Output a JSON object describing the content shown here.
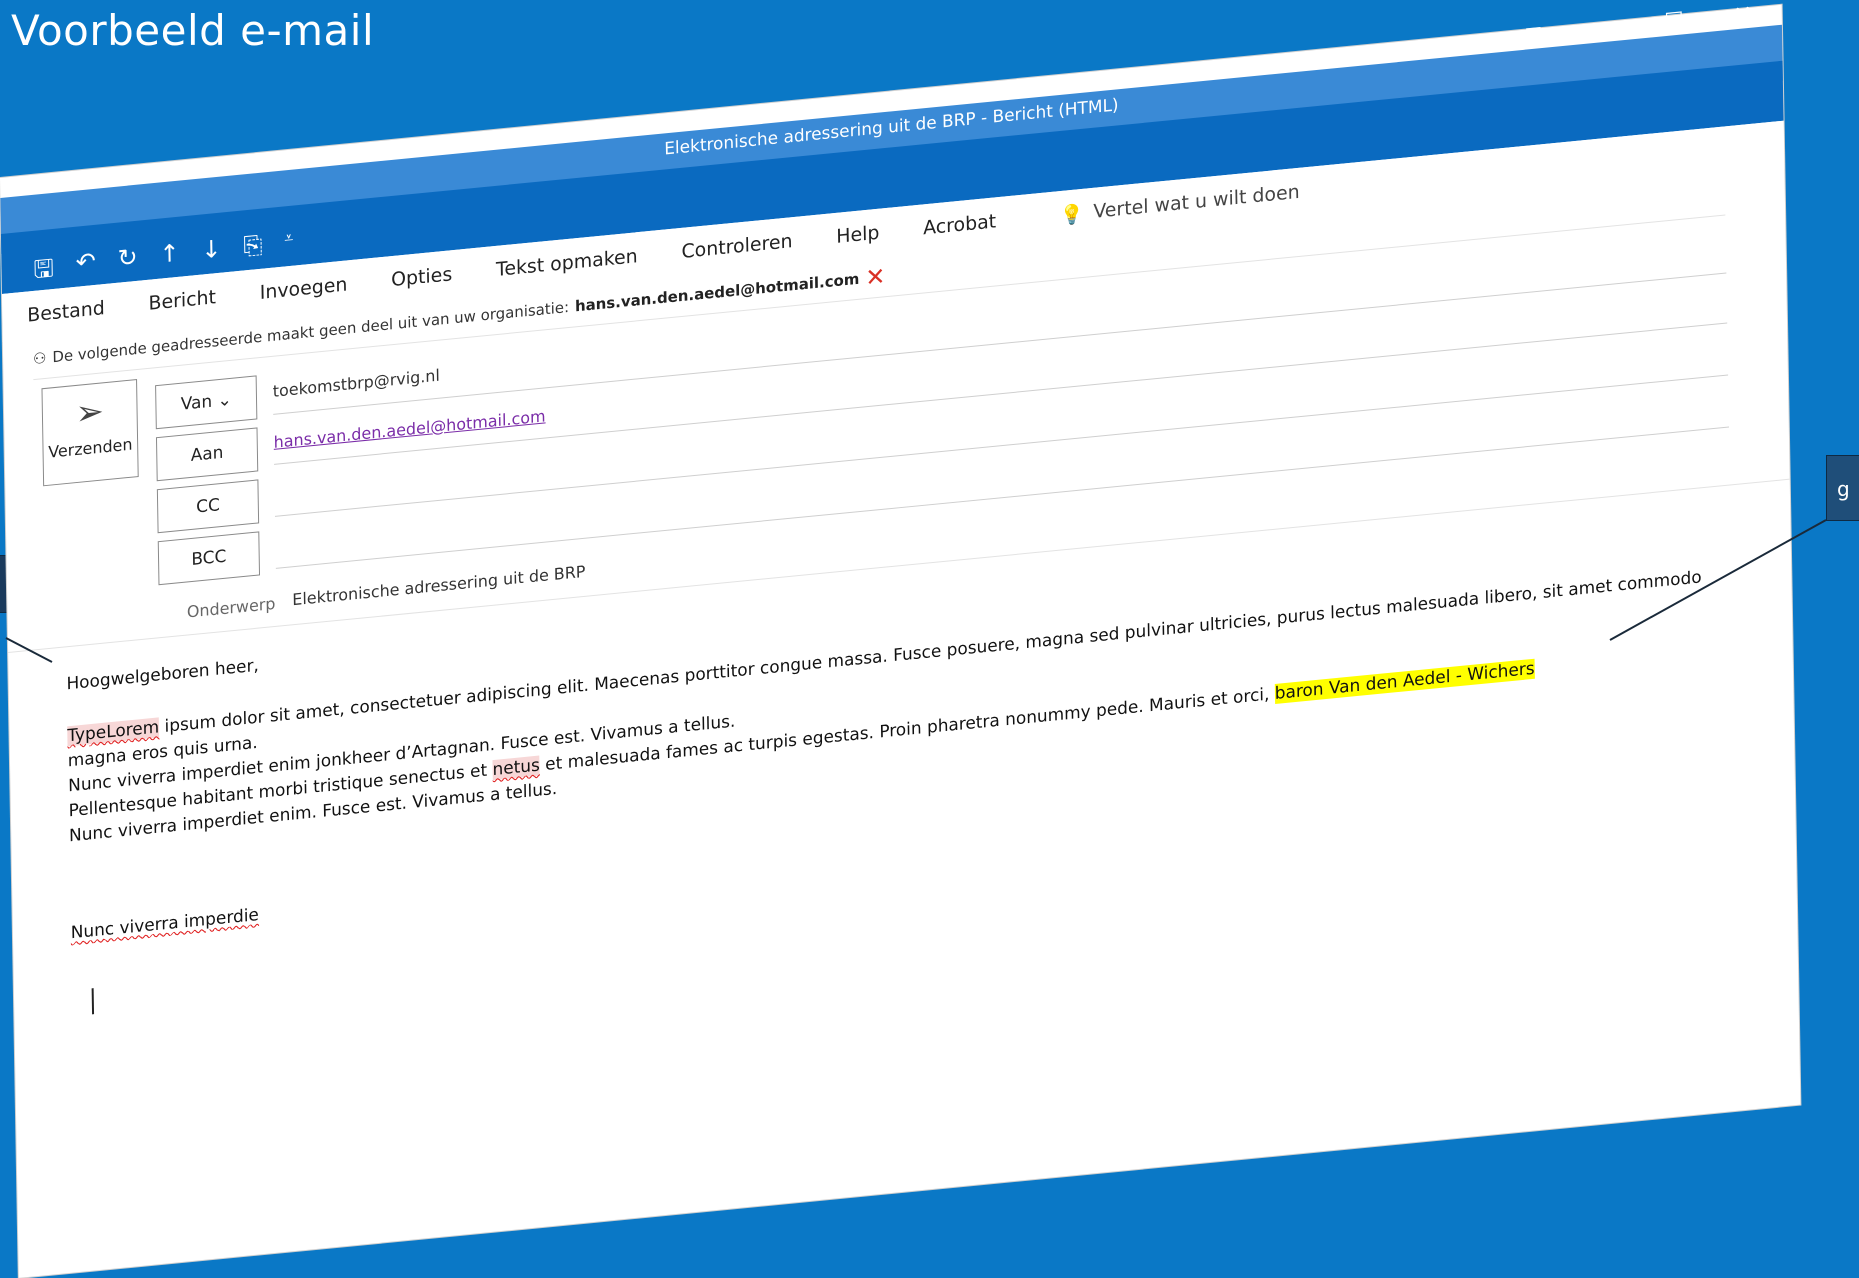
{
  "slide": {
    "title": "Voorbeeld e-mail"
  },
  "callout_right": {
    "text": "g"
  },
  "window": {
    "title": "Elektronische adressering uit de BRP  -  Bericht (HTML)",
    "quick_access": [
      "save-icon",
      "undo-icon",
      "redo-icon",
      "up-arrow-icon",
      "down-arrow-icon",
      "clipboard-icon",
      "customize-icon"
    ],
    "controls": [
      "restore-ribbon-icon",
      "minimize-icon",
      "maximize-icon",
      "close-icon"
    ]
  },
  "tabs": [
    "Bestand",
    "Bericht",
    "Invoegen",
    "Opties",
    "Tekst opmaken",
    "Controleren",
    "Help",
    "Acrobat"
  ],
  "tell_me": "Vertel wat u wilt doen",
  "info_bar": {
    "text": "De volgende geadresseerde maakt geen deel uit van uw organisatie:",
    "address": "hans.van.den.aedel@hotmail.com"
  },
  "compose": {
    "send_label": "Verzenden",
    "from_label": "Van",
    "from_value": "toekomstbrp@rvig.nl",
    "to_label": "Aan",
    "to_value": "hans.van.den.aedel@hotmail.com",
    "cc_label": "CC",
    "bcc_label": "BCC",
    "subject_label": "Onderwerp",
    "subject_value": "Elektronische adressering uit de BRP"
  },
  "body": {
    "greeting": "Hoogwelgeboren heer,",
    "line1_a": "TypeLorem",
    "line1_b": " ipsum dolor sit amet, consectetuer adipiscing elit. Maecenas porttitor congue massa. Fusce posuere, magna sed pulvinar ultricies, purus lectus malesuada libero, sit amet commodo",
    "line2": "magna eros quis urna.",
    "line3": "Nunc viverra imperdiet enim jonkheer d’Artagnan. Fusce est. Vivamus a tellus.",
    "line4_a": "Pellentesque habitant morbi tristique senectus et ",
    "line4_b": "netus",
    "line4_c": " et malesuada fames ac turpis egestas. Proin pharetra nonummy pede. Mauris et orci, ",
    "line4_hl": "baron Van den Aedel - Wichers",
    "line5": "Nunc viverra imperdiet enim. Fusce est. Vivamus a tellus.",
    "signature": "Nunc viverra imperdie"
  }
}
